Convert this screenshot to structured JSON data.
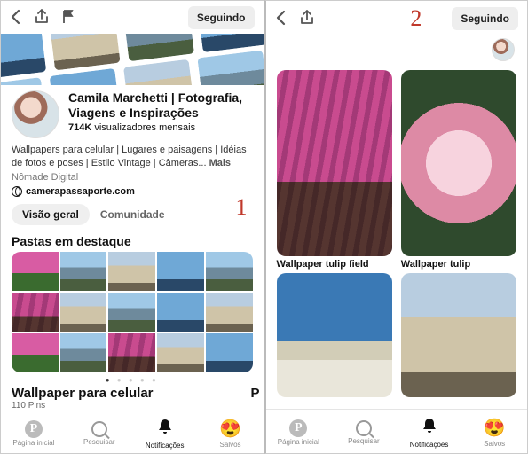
{
  "annotation": {
    "panel1": "1",
    "panel2": "2"
  },
  "nav": {
    "follow_label": "Seguindo"
  },
  "profile": {
    "name": "Camila Marchetti | Fotografia, Viagens e Inspirações",
    "stat_number": "714K",
    "stat_label": " visualizadores mensais",
    "bio": "Wallpapers para celular | Lugares e paisagens | Idéias de fotos e poses | Estilo Vintage | Câmeras... ",
    "more": "Mais",
    "subtitle": "Nômade Digital",
    "link": "camerapassaporte.com"
  },
  "tabs": {
    "overview": "Visão geral",
    "community": "Comunidade"
  },
  "featured": {
    "section_title": "Pastas em destaque",
    "board_title": "Wallpaper para celular",
    "pin_count": "110 Pins",
    "next_initial": "P"
  },
  "pins": {
    "p1": "Wallpaper tulip field",
    "p2": "Wallpaper tulip"
  },
  "tabbar": {
    "home": "Página inicial",
    "search": "Pesquisar",
    "notif": "Notificações",
    "saved": "Salvos"
  }
}
